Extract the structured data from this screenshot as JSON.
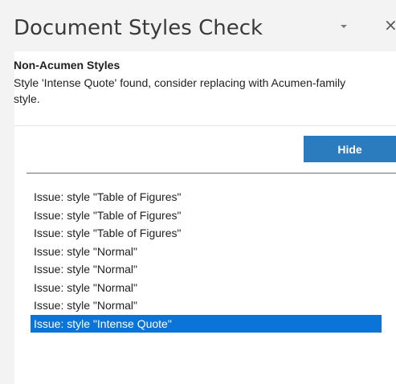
{
  "pane": {
    "title": "Document Styles Check",
    "menu_icon": "chevron-down-icon",
    "close_icon": "close-icon",
    "close_glyph": "×"
  },
  "message": {
    "heading": "Non-Acumen Styles",
    "body": "Style 'Intense Quote' found, consider replacing with Acumen-family style."
  },
  "hide_button": {
    "label": "Hide"
  },
  "issues": {
    "items": [
      "Issue: style \"Table of Figures\"",
      "Issue: style \"Table of Figures\"",
      "Issue: style \"Table of Figures\"",
      "Issue: style \"Normal\"",
      "Issue: style \"Normal\"",
      "Issue: style \"Normal\"",
      "Issue: style \"Normal\"",
      "Issue: style \"Intense Quote\""
    ],
    "selected_index": 7
  },
  "colors": {
    "accent": "#2b7bbf",
    "selection": "#0a74d9",
    "pane_background": "#f3f3f3"
  }
}
